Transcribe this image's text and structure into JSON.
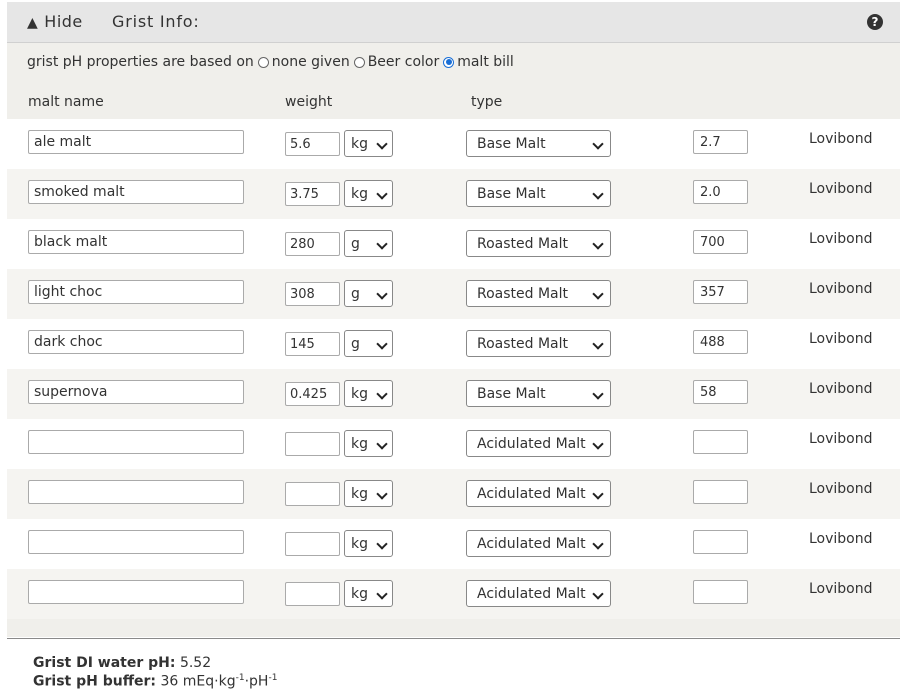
{
  "header": {
    "hide_label": "Hide",
    "hide_arrow": "▲",
    "title": "Grist Info:",
    "help_glyph": "?"
  },
  "ph_basis": {
    "label": "grist pH properties are based on",
    "options": [
      {
        "label": "none given",
        "checked": false
      },
      {
        "label": "Beer color",
        "checked": false
      },
      {
        "label": "malt bill",
        "checked": true
      }
    ]
  },
  "columns": {
    "name": "malt name",
    "weight": "weight",
    "type": "type"
  },
  "malts": [
    {
      "name": "ale malt",
      "weight": "5.6",
      "unit": "kg",
      "type": "Base Malt",
      "color": "2.7",
      "color_unit": "Lovibond"
    },
    {
      "name": "smoked malt",
      "weight": "3.75",
      "unit": "kg",
      "type": "Base Malt",
      "color": "2.0",
      "color_unit": "Lovibond"
    },
    {
      "name": "black malt",
      "weight": "280",
      "unit": "g",
      "type": "Roasted Malt",
      "color": "700",
      "color_unit": "Lovibond"
    },
    {
      "name": "light choc",
      "weight": "308",
      "unit": "g",
      "type": "Roasted Malt",
      "color": "357",
      "color_unit": "Lovibond"
    },
    {
      "name": "dark choc",
      "weight": "145",
      "unit": "g",
      "type": "Roasted Malt",
      "color": "488",
      "color_unit": "Lovibond"
    },
    {
      "name": "supernova",
      "weight": "0.425",
      "unit": "kg",
      "type": "Base Malt",
      "color": "58",
      "color_unit": "Lovibond"
    },
    {
      "name": "",
      "weight": "",
      "unit": "kg",
      "type": "Acidulated Malt",
      "color": "",
      "color_unit": "Lovibond"
    },
    {
      "name": "",
      "weight": "",
      "unit": "kg",
      "type": "Acidulated Malt",
      "color": "",
      "color_unit": "Lovibond"
    },
    {
      "name": "",
      "weight": "",
      "unit": "kg",
      "type": "Acidulated Malt",
      "color": "",
      "color_unit": "Lovibond"
    },
    {
      "name": "",
      "weight": "",
      "unit": "kg",
      "type": "Acidulated Malt",
      "color": "",
      "color_unit": "Lovibond"
    }
  ],
  "results": {
    "di_ph_label": "Grist DI water pH:",
    "di_ph_value": "5.52",
    "buffer_label": "Grist pH buffer:",
    "buffer_value": "36 mEq·kg",
    "buffer_exp1": "-1",
    "buffer_mid": "·pH",
    "buffer_exp2": "-1"
  }
}
